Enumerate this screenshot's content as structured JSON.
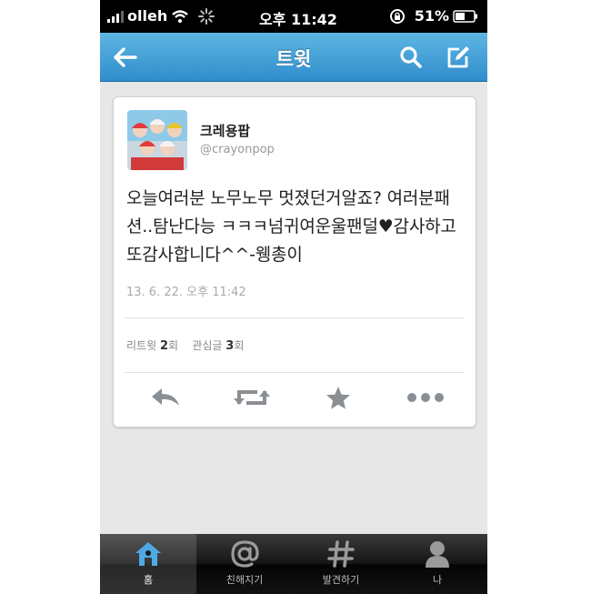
{
  "status_bar": {
    "carrier": "olleh",
    "time": "오후 11:42",
    "battery": "51%"
  },
  "nav": {
    "title": "트윗"
  },
  "tweet": {
    "display_name": "크레용팝",
    "handle": "@crayonpop",
    "text": "오늘여러분 노무노무 멋졌던거알죠? 여러분패션..탐난다능 ㅋㅋㅋ넘귀여운울팬덜♥감사하고또감사합니다^^-웽총이",
    "timestamp": "13. 6. 22. 오후 11:42",
    "retweet_label": "리트윗",
    "retweet_count": "2",
    "retweet_unit": "회",
    "favorite_label": "관심글",
    "favorite_count": "3",
    "favorite_unit": "회"
  },
  "tabs": [
    {
      "label": "홈",
      "icon": "home-icon",
      "active": true
    },
    {
      "label": "친해지기",
      "icon": "at-icon",
      "active": false
    },
    {
      "label": "발견하기",
      "icon": "hash-icon",
      "active": false
    },
    {
      "label": "나",
      "icon": "person-icon",
      "active": false
    }
  ],
  "colors": {
    "nav_blue": "#3a98d3",
    "tab_active_icon": "#4fa9e6"
  }
}
